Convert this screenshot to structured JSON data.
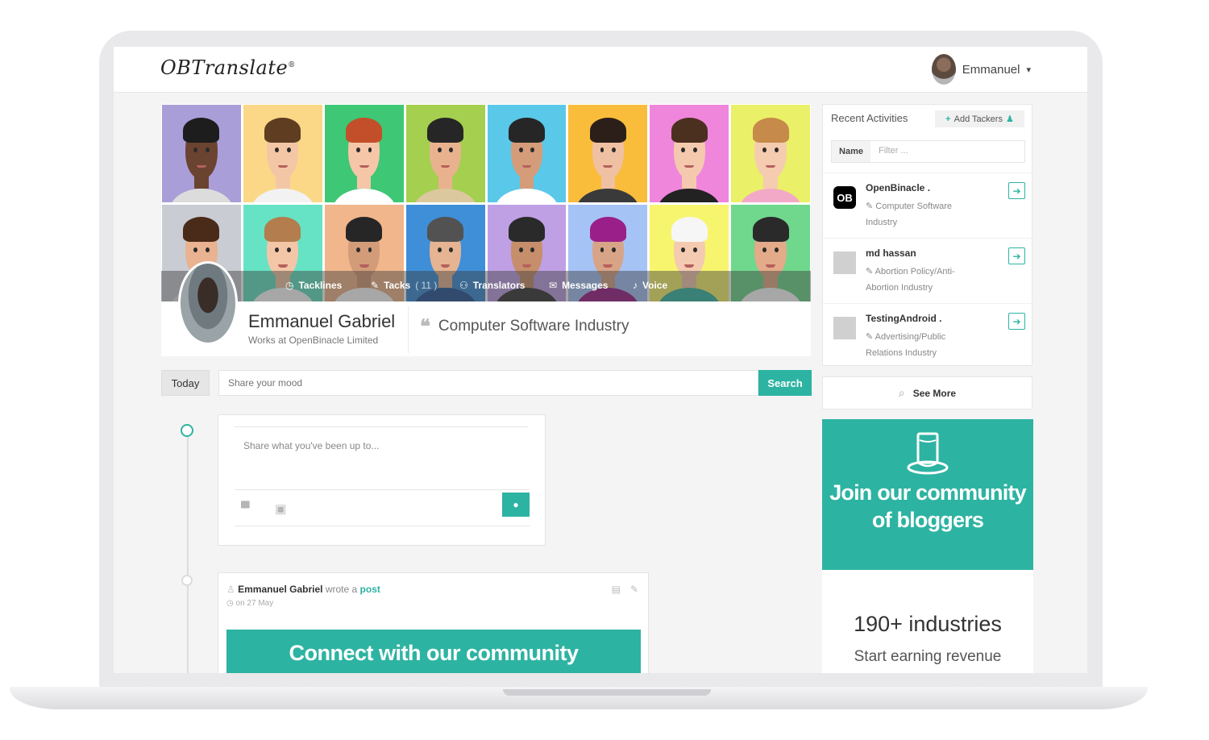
{
  "header": {
    "logo": "OBTranslate",
    "logo_mark": "®",
    "user_name": "Emmanuel",
    "user_caret": "▾"
  },
  "cover": {
    "faces": [
      {
        "bg": "#a99ed8",
        "skin": "#6b4331",
        "hair": "#1d1d1d",
        "shirt": "#dcdcdc"
      },
      {
        "bg": "#fbd888",
        "skin": "#f3c7a6",
        "hair": "#5e3d21",
        "shirt": "#f2f2f2"
      },
      {
        "bg": "#3ec774",
        "skin": "#f6c6a8",
        "hair": "#c34f2a",
        "shirt": "#ffffff"
      },
      {
        "bg": "#a5cf4f",
        "skin": "#e9b28e",
        "hair": "#262626",
        "shirt": "#dcc89e"
      },
      {
        "bg": "#5ac8e8",
        "skin": "#d59c7a",
        "hair": "#262626",
        "shirt": "#ffffff"
      },
      {
        "bg": "#f9bd3b",
        "skin": "#f0c0a2",
        "hair": "#2c1f1a",
        "shirt": "#3a3a3a"
      },
      {
        "bg": "#ef86dc",
        "skin": "#f4c9ad",
        "hair": "#4b3020",
        "shirt": "#222222"
      },
      {
        "bg": "#eaf067",
        "skin": "#f5ccb0",
        "hair": "#c68a4a",
        "shirt": "#f2a9c8"
      },
      {
        "bg": "#c9ccd2",
        "skin": "#e9b290",
        "hair": "#4a2b1a",
        "shirt": "#e4e4e4"
      },
      {
        "bg": "#66e3c5",
        "skin": "#f3c6a7",
        "hair": "#b37d4e",
        "shirt": "#ffffff"
      },
      {
        "bg": "#f1b68b",
        "skin": "#d39c79",
        "hair": "#262626",
        "shirt": "#ffffff"
      },
      {
        "bg": "#3f8fd8",
        "skin": "#e6b492",
        "hair": "#525252",
        "shirt": "#2a5796"
      },
      {
        "bg": "#bfa0e4",
        "skin": "#c68e6a",
        "hair": "#2a2a2a",
        "shirt": "#3a3a3a"
      },
      {
        "bg": "#a6c3f6",
        "skin": "#d8a487",
        "hair": "#9b1f88",
        "shirt": "#9b1f88"
      },
      {
        "bg": "#f7f56e",
        "skin": "#f4cbb0",
        "hair": "#f6f6f6",
        "shirt": "#3bb8a6"
      },
      {
        "bg": "#6fd88c",
        "skin": "#e3ab89",
        "hair": "#2a2a2a",
        "shirt": "#ffffff"
      }
    ]
  },
  "tabs": [
    {
      "icon": "◷",
      "label": "Tacklines",
      "count": ""
    },
    {
      "icon": "✎",
      "label": "Tacks",
      "count": "( 11 )"
    },
    {
      "icon": "⚇",
      "label": "Translators",
      "count": ""
    },
    {
      "icon": "✉",
      "label": "Messages",
      "count": ""
    },
    {
      "icon": "♪",
      "label": "Voice",
      "count": ""
    }
  ],
  "profile": {
    "name": "Emmanuel Gabriel",
    "works_at": "Works at OpenBinacle Limited",
    "quote_glyph": "❝",
    "industry": "Computer Software Industry"
  },
  "feed": {
    "today_label": "Today",
    "mood_placeholder": "Share your mood",
    "search_label": "Search",
    "compose_placeholder": "Share what you've been up to...",
    "compose_icons": [
      "comment-icon",
      "image-icon"
    ],
    "send_icon": "chat-bubble-icon"
  },
  "post": {
    "author": "Emmanuel Gabriel",
    "wrote": "wrote a",
    "type_link": "post",
    "date": "on 27 May",
    "banner": "Connect with our community"
  },
  "activities": {
    "title": "Recent Activities",
    "add_trackers": "Add Tackers",
    "filter_label": "Name",
    "filter_placeholder": "Filter ...",
    "items": [
      {
        "logo": "OB",
        "name": "OpenBinacle .",
        "industry": "Computer Software Industry"
      },
      {
        "logo": "",
        "name": "md hassan",
        "industry": "Abortion Policy/Anti-Abortion Industry"
      },
      {
        "logo": "",
        "name": "TestingAndroid .",
        "industry": "Advertising/Public Relations Industry"
      }
    ],
    "see_more": "See More"
  },
  "join": {
    "text": "Join our community of bloggers"
  },
  "stats": {
    "big": "190+ industries",
    "small": "Start earning revenue"
  },
  "colors": {
    "accent": "#2db3a2"
  }
}
